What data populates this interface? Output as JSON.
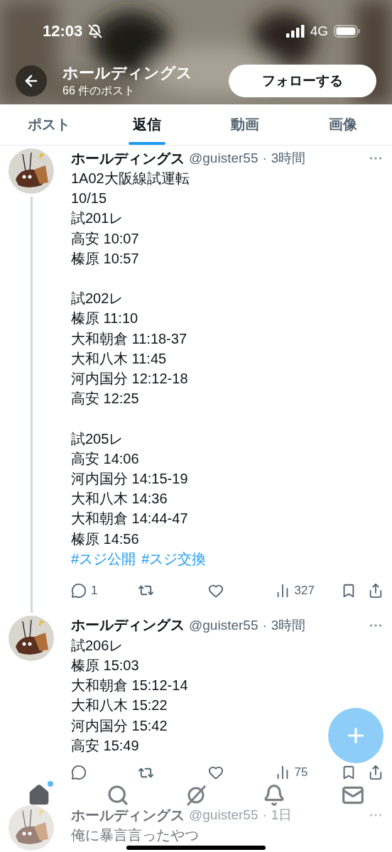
{
  "status_bar": {
    "time": "12:03",
    "network": "4G",
    "silent": true
  },
  "header": {
    "name": "ホールディングス",
    "post_count": "66 件のポスト",
    "follow_button": "フォローする"
  },
  "tabs": [
    {
      "label": "ポスト",
      "selected": false
    },
    {
      "label": "返信",
      "selected": true
    },
    {
      "label": "動画",
      "selected": false
    },
    {
      "label": "画像",
      "selected": false
    }
  ],
  "posts": [
    {
      "name": "ホールディングス",
      "handle": "@guister55",
      "separator": "·",
      "time": "3時間",
      "paragraphs": [
        [
          "1A02大阪線試運転",
          "10/15",
          "試201レ",
          "高安 10:07",
          "榛原 10:57"
        ],
        [
          "試202レ",
          "榛原 11:10",
          "大和朝倉 11:18-37",
          "大和八木 11:45",
          "河内国分 12:12-18",
          "高安 12:25"
        ],
        [
          "試205レ",
          "高安 14:06",
          "河内国分 14:15-19",
          "大和八木 14:36",
          "大和朝倉 14:44-47",
          "榛原 14:56"
        ]
      ],
      "hashtags": [
        "#スジ公開",
        "#スジ交換"
      ],
      "replies": "1",
      "views": "327",
      "thread_continues": true
    },
    {
      "name": "ホールディングス",
      "handle": "@guister55",
      "separator": "·",
      "time": "3時間",
      "paragraphs": [
        [
          "試206レ",
          "榛原 15:03",
          "大和朝倉 15:12-14",
          "大和八木 15:22",
          "河内国分 15:42",
          "高安 15:49"
        ]
      ],
      "views": "75"
    }
  ],
  "nav": [
    {
      "kind": "home",
      "selected": true,
      "badge": true
    },
    {
      "kind": "search",
      "selected": false,
      "badge": false
    },
    {
      "kind": "grok",
      "selected": false,
      "badge": false
    },
    {
      "kind": "notifications",
      "selected": false,
      "badge": false
    },
    {
      "kind": "messages",
      "selected": false,
      "badge": false
    }
  ],
  "faded_post": {
    "name": "ホールディングス",
    "handle": "@guister55",
    "separator": "·",
    "time": "1日",
    "text": "俺に暴言言ったやつ"
  }
}
